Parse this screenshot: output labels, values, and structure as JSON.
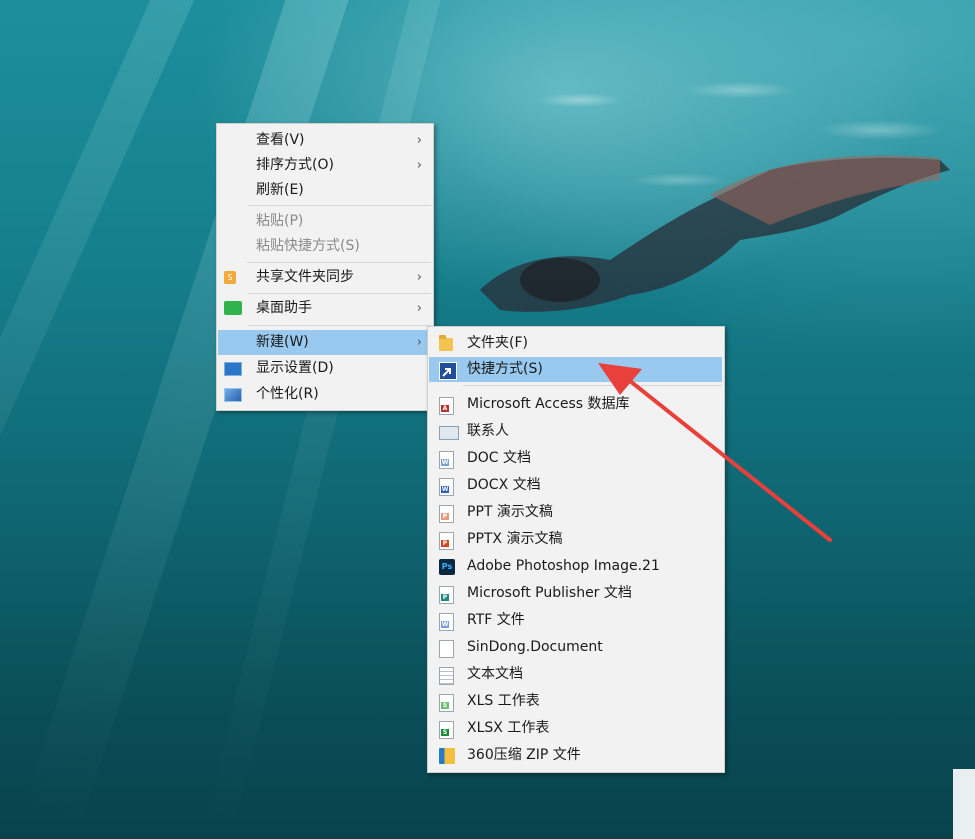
{
  "context_menu": {
    "items": [
      {
        "label": "查看(V)",
        "has_submenu": true,
        "enabled": true
      },
      {
        "label": "排序方式(O)",
        "has_submenu": true,
        "enabled": true
      },
      {
        "label": "刷新(E)",
        "has_submenu": false,
        "enabled": true
      },
      {
        "label": "粘贴(P)",
        "has_submenu": false,
        "enabled": false
      },
      {
        "label": "粘贴快捷方式(S)",
        "has_submenu": false,
        "enabled": false
      },
      {
        "label": "共享文件夹同步",
        "has_submenu": true,
        "enabled": true,
        "icon": "share-sync-icon"
      },
      {
        "label": "桌面助手",
        "has_submenu": true,
        "enabled": true,
        "icon": "desktop-assistant-icon"
      },
      {
        "label": "新建(W)",
        "has_submenu": true,
        "enabled": true,
        "highlighted": true
      },
      {
        "label": "显示设置(D)",
        "has_submenu": false,
        "enabled": true,
        "icon": "display-icon"
      },
      {
        "label": "个性化(R)",
        "has_submenu": false,
        "enabled": true,
        "icon": "personalize-icon"
      }
    ],
    "arrow_glyph": "›"
  },
  "new_submenu": {
    "items": [
      {
        "label": "文件夹(F)",
        "icon": "folder-icon"
      },
      {
        "label": "快捷方式(S)",
        "icon": "shortcut-icon",
        "highlighted": true
      },
      {
        "label": "Microsoft Access 数据库",
        "icon": "access-file-icon"
      },
      {
        "label": "联系人",
        "icon": "contact-icon"
      },
      {
        "label": "DOC 文档",
        "icon": "doc-file-icon"
      },
      {
        "label": "DOCX 文档",
        "icon": "docx-file-icon"
      },
      {
        "label": "PPT 演示文稿",
        "icon": "ppt-file-icon"
      },
      {
        "label": "PPTX 演示文稿",
        "icon": "pptx-file-icon"
      },
      {
        "label": "Adobe Photoshop Image.21",
        "icon": "photoshop-icon"
      },
      {
        "label": "Microsoft Publisher 文档",
        "icon": "publisher-file-icon"
      },
      {
        "label": "RTF 文件",
        "icon": "rtf-file-icon"
      },
      {
        "label": "SinDong.Document",
        "icon": "blank-file-icon"
      },
      {
        "label": "文本文档",
        "icon": "text-file-icon"
      },
      {
        "label": "XLS 工作表",
        "icon": "xls-file-icon"
      },
      {
        "label": "XLSX 工作表",
        "icon": "xlsx-file-icon"
      },
      {
        "label": "360压缩 ZIP 文件",
        "icon": "zip-archive-icon"
      }
    ]
  },
  "icon_glyphs": {
    "photoshop": "Ps",
    "share": "S",
    "word": "W",
    "ppt": "P",
    "access": "A",
    "publisher": "P",
    "excel": "S"
  },
  "colors": {
    "menu_bg": "#f2f2f2",
    "highlight": "#99c9ef",
    "annotation_arrow": "#e8403a"
  }
}
